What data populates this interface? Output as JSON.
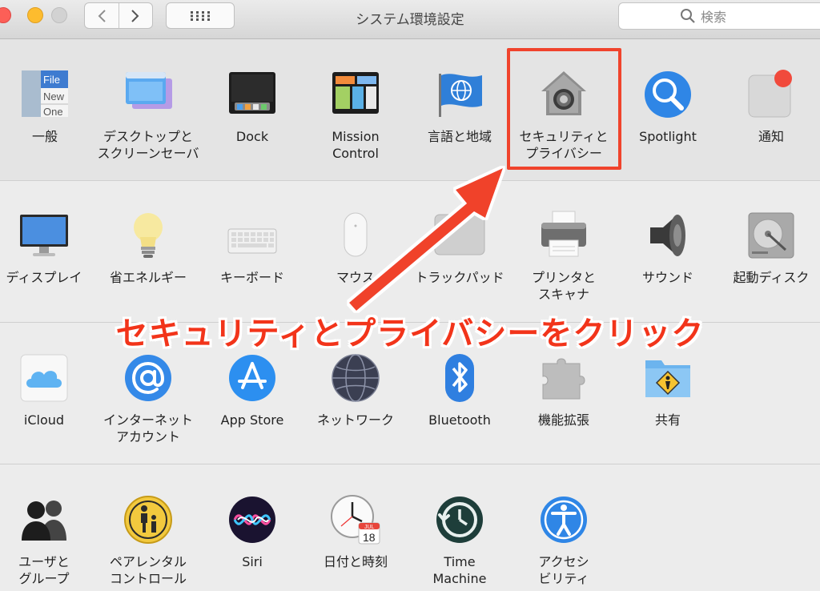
{
  "window": {
    "title": "システム環境設定"
  },
  "search": {
    "placeholder": "検索"
  },
  "rows": [
    [
      {
        "label": "一般",
        "icon": "general-icon"
      },
      {
        "label": "デスクトップと\nスクリーンセーバ",
        "icon": "desktop-screensaver-icon"
      },
      {
        "label": "Dock",
        "icon": "dock-icon"
      },
      {
        "label": "Mission\nControl",
        "icon": "mission-control-icon"
      },
      {
        "label": "言語と地域",
        "icon": "globe-flag-icon"
      },
      {
        "label": "セキュリティと\nプライバシー",
        "icon": "security-house-icon"
      },
      {
        "label": "Spotlight",
        "icon": "magnifier-icon"
      },
      {
        "label": "通知",
        "icon": "notifications-icon"
      }
    ],
    [
      {
        "label": "ディスプレイ",
        "icon": "display-icon"
      },
      {
        "label": "省エネルギー",
        "icon": "lightbulb-icon"
      },
      {
        "label": "キーボード",
        "icon": "keyboard-icon"
      },
      {
        "label": "マウス",
        "icon": "mouse-icon"
      },
      {
        "label": "トラックパッド",
        "icon": "trackpad-icon"
      },
      {
        "label": "プリンタと\nスキャナ",
        "icon": "printer-icon"
      },
      {
        "label": "サウンド",
        "icon": "speaker-icon"
      },
      {
        "label": "起動ディスク",
        "icon": "hard-disk-icon"
      }
    ],
    [
      {
        "label": "iCloud",
        "icon": "cloud-icon"
      },
      {
        "label": "インターネット\nアカウント",
        "icon": "at-sign-icon"
      },
      {
        "label": "App Store",
        "icon": "app-store-icon"
      },
      {
        "label": "ネットワーク",
        "icon": "network-globe-icon"
      },
      {
        "label": "Bluetooth",
        "icon": "bluetooth-icon"
      },
      {
        "label": "機能拡張",
        "icon": "puzzle-piece-icon"
      },
      {
        "label": "共有",
        "icon": "shared-folder-icon"
      }
    ],
    [
      {
        "label": "ユーザと\nグループ",
        "icon": "users-silhouette-icon"
      },
      {
        "label": "ペアレンタル\nコントロール",
        "icon": "parental-controls-icon"
      },
      {
        "label": "Siri",
        "icon": "siri-icon"
      },
      {
        "label": "日付と時刻",
        "icon": "clock-calendar-icon"
      },
      {
        "label": "Time\nMachine",
        "icon": "time-machine-icon"
      },
      {
        "label": "アクセシ\nビリティ",
        "icon": "accessibility-icon"
      }
    ]
  ],
  "icon_text": {
    "general": [
      "File",
      "New",
      "One"
    ],
    "calendar_month": "JUL",
    "calendar_day": "18"
  },
  "annotation": {
    "callout": "セキュリティとプライバシーをクリック",
    "color": "#f0432c"
  }
}
